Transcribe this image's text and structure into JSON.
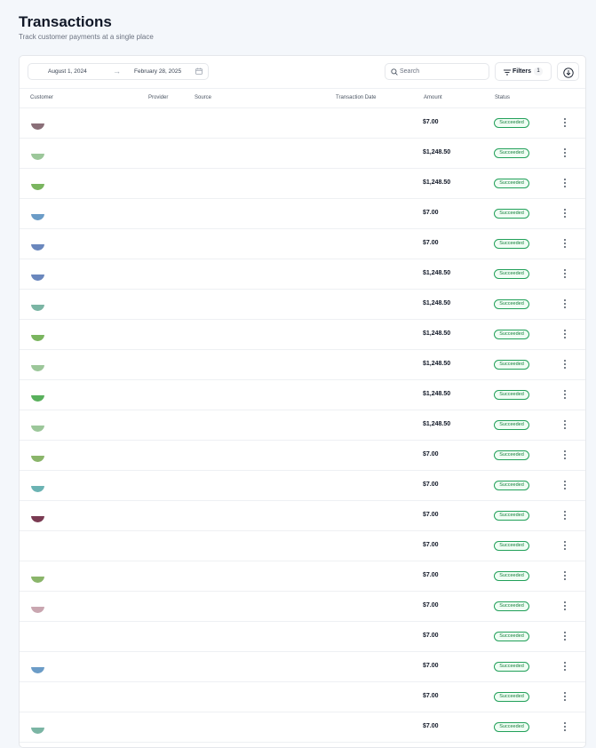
{
  "page": {
    "title": "Transactions",
    "subtitle": "Track customer payments at a single place"
  },
  "toolbar": {
    "date_start": "August 1, 2024",
    "date_end": "February 28, 2025",
    "search_placeholder": "Search",
    "filters_label": "Filters",
    "filters_count": "1"
  },
  "table": {
    "columns": [
      "Customer",
      "Provider",
      "Source",
      "Transaction Date",
      "Amount",
      "Status"
    ],
    "rows": [
      {
        "amount": "$7.00",
        "status": "Succeeded",
        "avatar_color": "#8a6f78"
      },
      {
        "amount": "$1,248.50",
        "status": "Succeeded",
        "avatar_color": "#9cc79a"
      },
      {
        "amount": "$1,248.50",
        "status": "Succeeded",
        "avatar_color": "#7ab55f"
      },
      {
        "amount": "$7.00",
        "status": "Succeeded",
        "avatar_color": "#6b9cc7"
      },
      {
        "amount": "$7.00",
        "status": "Succeeded",
        "avatar_color": "#6a87bd"
      },
      {
        "amount": "$1,248.50",
        "status": "Succeeded",
        "avatar_color": "#6a87bd"
      },
      {
        "amount": "$1,248.50",
        "status": "Succeeded",
        "avatar_color": "#7bb5a4"
      },
      {
        "amount": "$1,248.50",
        "status": "Succeeded",
        "avatar_color": "#7ab55f"
      },
      {
        "amount": "$1,248.50",
        "status": "Succeeded",
        "avatar_color": "#9cc79a"
      },
      {
        "amount": "$1,248.50",
        "status": "Succeeded",
        "avatar_color": "#59b05c"
      },
      {
        "amount": "$1,248.50",
        "status": "Succeeded",
        "avatar_color": "#9cc79a"
      },
      {
        "amount": "$7.00",
        "status": "Succeeded",
        "avatar_color": "#8ab56a"
      },
      {
        "amount": "$7.00",
        "status": "Succeeded",
        "avatar_color": "#6bb3b3"
      },
      {
        "amount": "$7.00",
        "status": "Succeeded",
        "avatar_color": "#7a3b52"
      },
      {
        "amount": "$7.00",
        "status": "Succeeded",
        "avatar_color": ""
      },
      {
        "amount": "$7.00",
        "status": "Succeeded",
        "avatar_color": "#8ab56a"
      },
      {
        "amount": "$7.00",
        "status": "Succeeded",
        "avatar_color": "#c9a6b0"
      },
      {
        "amount": "$7.00",
        "status": "Succeeded",
        "avatar_color": ""
      },
      {
        "amount": "$7.00",
        "status": "Succeeded",
        "avatar_color": "#6b9cc7"
      },
      {
        "amount": "$7.00",
        "status": "Succeeded",
        "avatar_color": ""
      },
      {
        "amount": "$7.00",
        "status": "Succeeded",
        "avatar_color": "#7bb5a4"
      }
    ]
  }
}
